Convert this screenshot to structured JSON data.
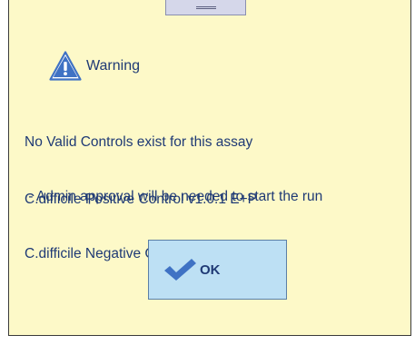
{
  "dialog": {
    "title": "Warning",
    "message_lines": [
      "No Valid Controls exist for this assay",
      " - Admin approval will be needed to start the run"
    ],
    "controls": [
      "C.difficile Positive Control v1.0.1 E+P",
      "C.difficile Negative Control v1.0.1 E+P"
    ],
    "ok_label": "OK"
  },
  "icons": {
    "warning": "warning-triangle-icon",
    "ok": "checkmark-icon",
    "grip": "drag-grip-icon"
  },
  "colors": {
    "dialog_background": "#fdf9c8",
    "text": "#1f3a75",
    "button_background": "#bde0f4",
    "icon_blue": "#3f72c4"
  }
}
